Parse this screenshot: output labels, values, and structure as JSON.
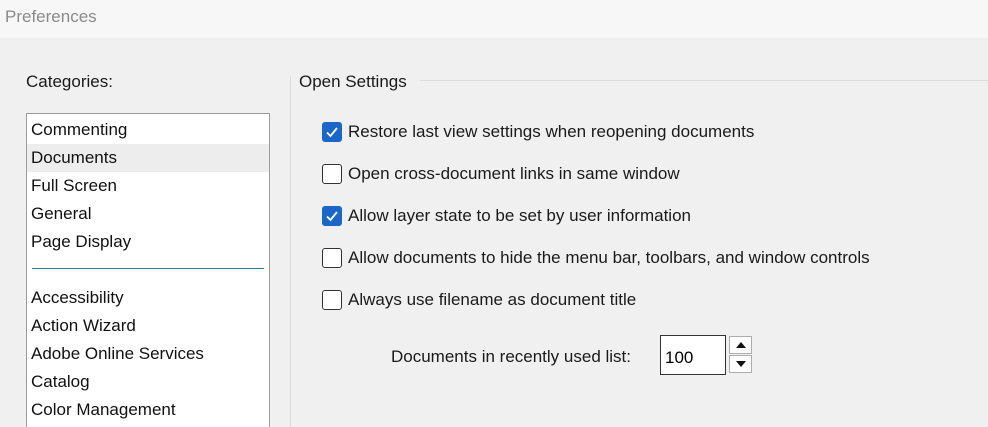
{
  "window": {
    "title": "Preferences"
  },
  "sidebar": {
    "label": "Categories:",
    "group1": [
      "Commenting",
      "Documents",
      "Full Screen",
      "General",
      "Page Display"
    ],
    "group2": [
      "Accessibility",
      "Action Wizard",
      "Adobe Online Services",
      "Catalog",
      "Color Management"
    ],
    "selected": "Documents"
  },
  "open_settings": {
    "title": "Open Settings",
    "options": [
      {
        "label": "Restore last view settings when reopening documents",
        "checked": true
      },
      {
        "label": "Open cross-document links in same window",
        "checked": false
      },
      {
        "label": "Allow layer state to be set by user information",
        "checked": true
      },
      {
        "label": "Allow documents to hide the menu bar, toolbars, and window controls",
        "checked": false
      },
      {
        "label": "Always use filename as document title",
        "checked": false
      }
    ],
    "recent_list": {
      "label": "Documents in recently used list:",
      "value": "100"
    }
  },
  "colors": {
    "checkbox_accent": "#1a67c9",
    "separator": "#2a7f8f",
    "selected_row": "#ededed"
  }
}
